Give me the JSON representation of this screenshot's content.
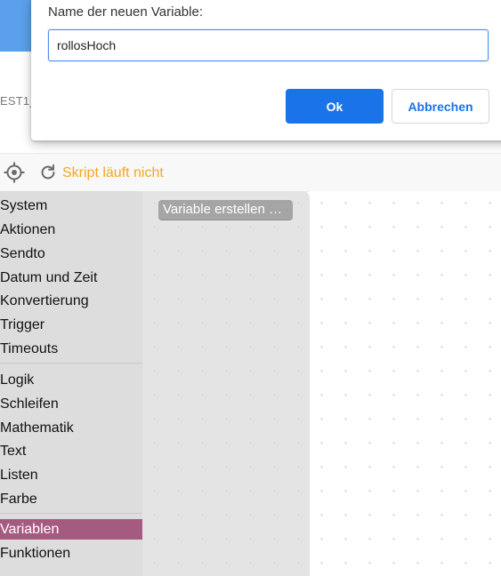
{
  "dialog": {
    "label": "Name der neuen Variable:",
    "input_value": "rollosHoch",
    "ok_label": "Ok",
    "cancel_label": "Abbrechen"
  },
  "background": {
    "tab_label_fragment": "EST1_"
  },
  "toolbar": {
    "status_text": "Skript läuft nicht",
    "status_color": "#f5a623"
  },
  "toolbox": {
    "categories": [
      {
        "label": "System"
      },
      {
        "label": "Aktionen"
      },
      {
        "label": "Sendto"
      },
      {
        "label": "Datum und Zeit"
      },
      {
        "label": "Konvertierung"
      },
      {
        "label": "Trigger"
      },
      {
        "label": "Timeouts"
      },
      {
        "label": "Logik"
      },
      {
        "label": "Schleifen"
      },
      {
        "label": "Mathematik"
      },
      {
        "label": "Text"
      },
      {
        "label": "Listen"
      },
      {
        "label": "Farbe"
      },
      {
        "label": "Variablen",
        "selected": true
      },
      {
        "label": "Funktionen"
      }
    ],
    "selected_color": "#a55b80"
  },
  "flyout": {
    "block_label": "Variable erstellen …"
  },
  "colors": {
    "accent": "#1a73e8",
    "header": "#5aa0ea"
  }
}
